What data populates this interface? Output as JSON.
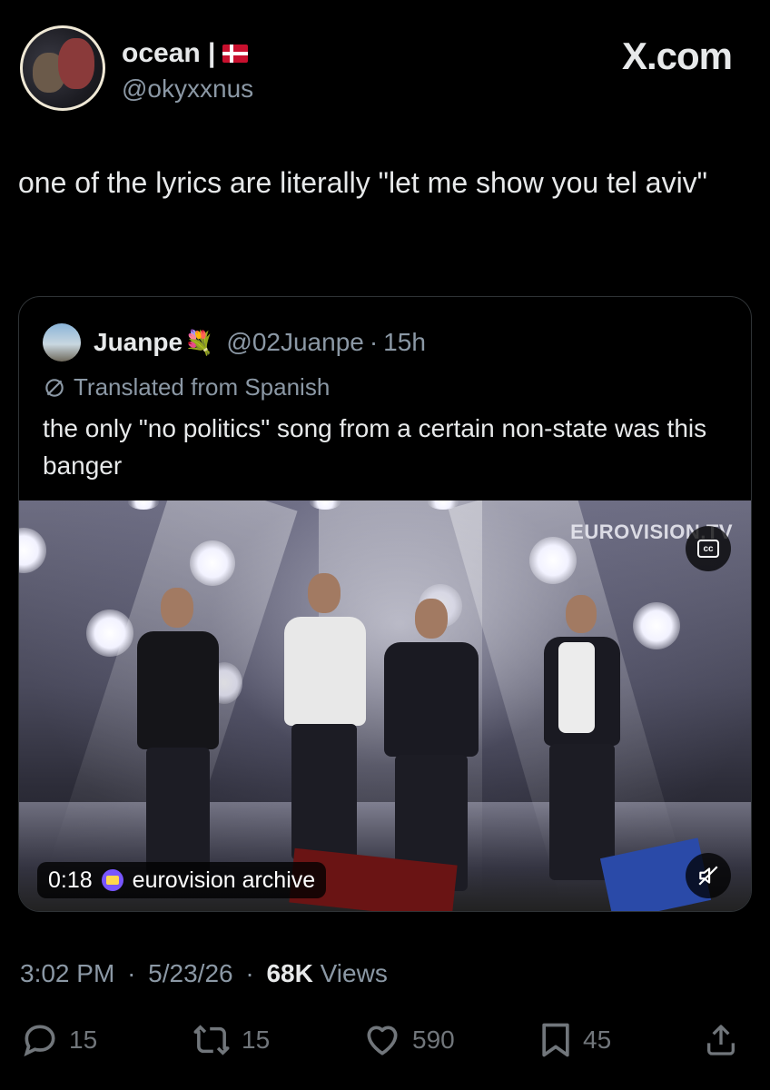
{
  "header": {
    "display_name": "ocean |",
    "flag_icon": "denmark-flag-icon",
    "handle": "@okyxxnus",
    "watermark": "X.com"
  },
  "tweet": {
    "text": "one of the lyrics are literally \"let me show you tel aviv\""
  },
  "quote": {
    "name": "Juanpe",
    "emoji": "💐",
    "handle": "@02Juanpe",
    "separator": "·",
    "time": "15h",
    "translated_label": "Translated from Spanish",
    "text": "the only \"no politics\" song from a certain non-state was this banger",
    "video": {
      "channel_logo": "EUROVISION.TV",
      "duration": "0:18",
      "source": "eurovision archive",
      "cc_icon": "closed-captions-icon",
      "mute_icon": "muted-speaker-icon"
    }
  },
  "meta": {
    "time": "3:02 PM",
    "sep1": "·",
    "date": "5/23/26",
    "sep2": "·",
    "views_count": "68K",
    "views_label": "Views"
  },
  "actions": {
    "replies": "15",
    "reposts": "15",
    "likes": "590",
    "bookmarks": "45"
  },
  "colors": {
    "background": "#000000",
    "text": "#e7e9ea",
    "secondary": "#8b98a5",
    "border": "#2f3336"
  }
}
